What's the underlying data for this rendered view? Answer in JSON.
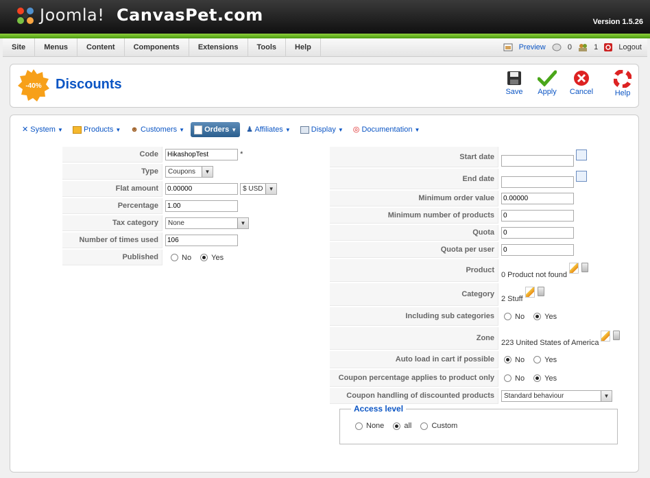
{
  "header": {
    "brand": "Joomla!",
    "site": "CanvasPet.com",
    "version": "Version 1.5.26"
  },
  "menu": {
    "items": [
      "Site",
      "Menus",
      "Content",
      "Components",
      "Extensions",
      "Tools",
      "Help"
    ],
    "preview": "Preview",
    "messages": "0",
    "users": "1",
    "logout": "Logout"
  },
  "toolbar": {
    "title": "Discounts",
    "badge": "-40%",
    "save": "Save",
    "apply": "Apply",
    "cancel": "Cancel",
    "help": "Help"
  },
  "submenu": {
    "items": [
      "System",
      "Products",
      "Customers",
      "Orders",
      "Affiliates",
      "Display",
      "Documentation"
    ],
    "active": "Orders"
  },
  "left": {
    "code": {
      "label": "Code",
      "value": "HikashopTest",
      "required": "*"
    },
    "type": {
      "label": "Type",
      "value": "Coupons"
    },
    "flat": {
      "label": "Flat amount",
      "value": "0.00000",
      "currency": "$ USD"
    },
    "percentage": {
      "label": "Percentage",
      "value": "1.00"
    },
    "tax": {
      "label": "Tax category",
      "value": "None"
    },
    "used": {
      "label": "Number of times used",
      "value": "106"
    },
    "published": {
      "label": "Published",
      "no": "No",
      "yes": "Yes",
      "selected": "Yes"
    }
  },
  "right": {
    "start": {
      "label": "Start date",
      "value": ""
    },
    "end": {
      "label": "End date",
      "value": ""
    },
    "minorder": {
      "label": "Minimum order value",
      "value": "0.00000"
    },
    "minprod": {
      "label": "Minimum number of products",
      "value": "0"
    },
    "quota": {
      "label": "Quota",
      "value": "0"
    },
    "quotauser": {
      "label": "Quota per user",
      "value": "0"
    },
    "product": {
      "label": "Product",
      "value": "0 Product not found"
    },
    "category": {
      "label": "Category",
      "value": "2 Stuff"
    },
    "subcat": {
      "label": "Including sub categories",
      "no": "No",
      "yes": "Yes",
      "selected": "Yes"
    },
    "zone": {
      "label": "Zone",
      "value": "223 United States of America"
    },
    "autoload": {
      "label": "Auto load in cart if possible",
      "no": "No",
      "yes": "Yes",
      "selected": "No"
    },
    "pctapply": {
      "label": "Coupon percentage applies to product only",
      "no": "No",
      "yes": "Yes",
      "selected": "Yes"
    },
    "handling": {
      "label": "Coupon handling of discounted products",
      "value": "Standard behaviour"
    }
  },
  "access": {
    "legend": "Access level",
    "none": "None",
    "all": "all",
    "custom": "Custom",
    "selected": "all"
  },
  "colors": {
    "accent": "#0b55c4",
    "green": "#6ab82a"
  }
}
